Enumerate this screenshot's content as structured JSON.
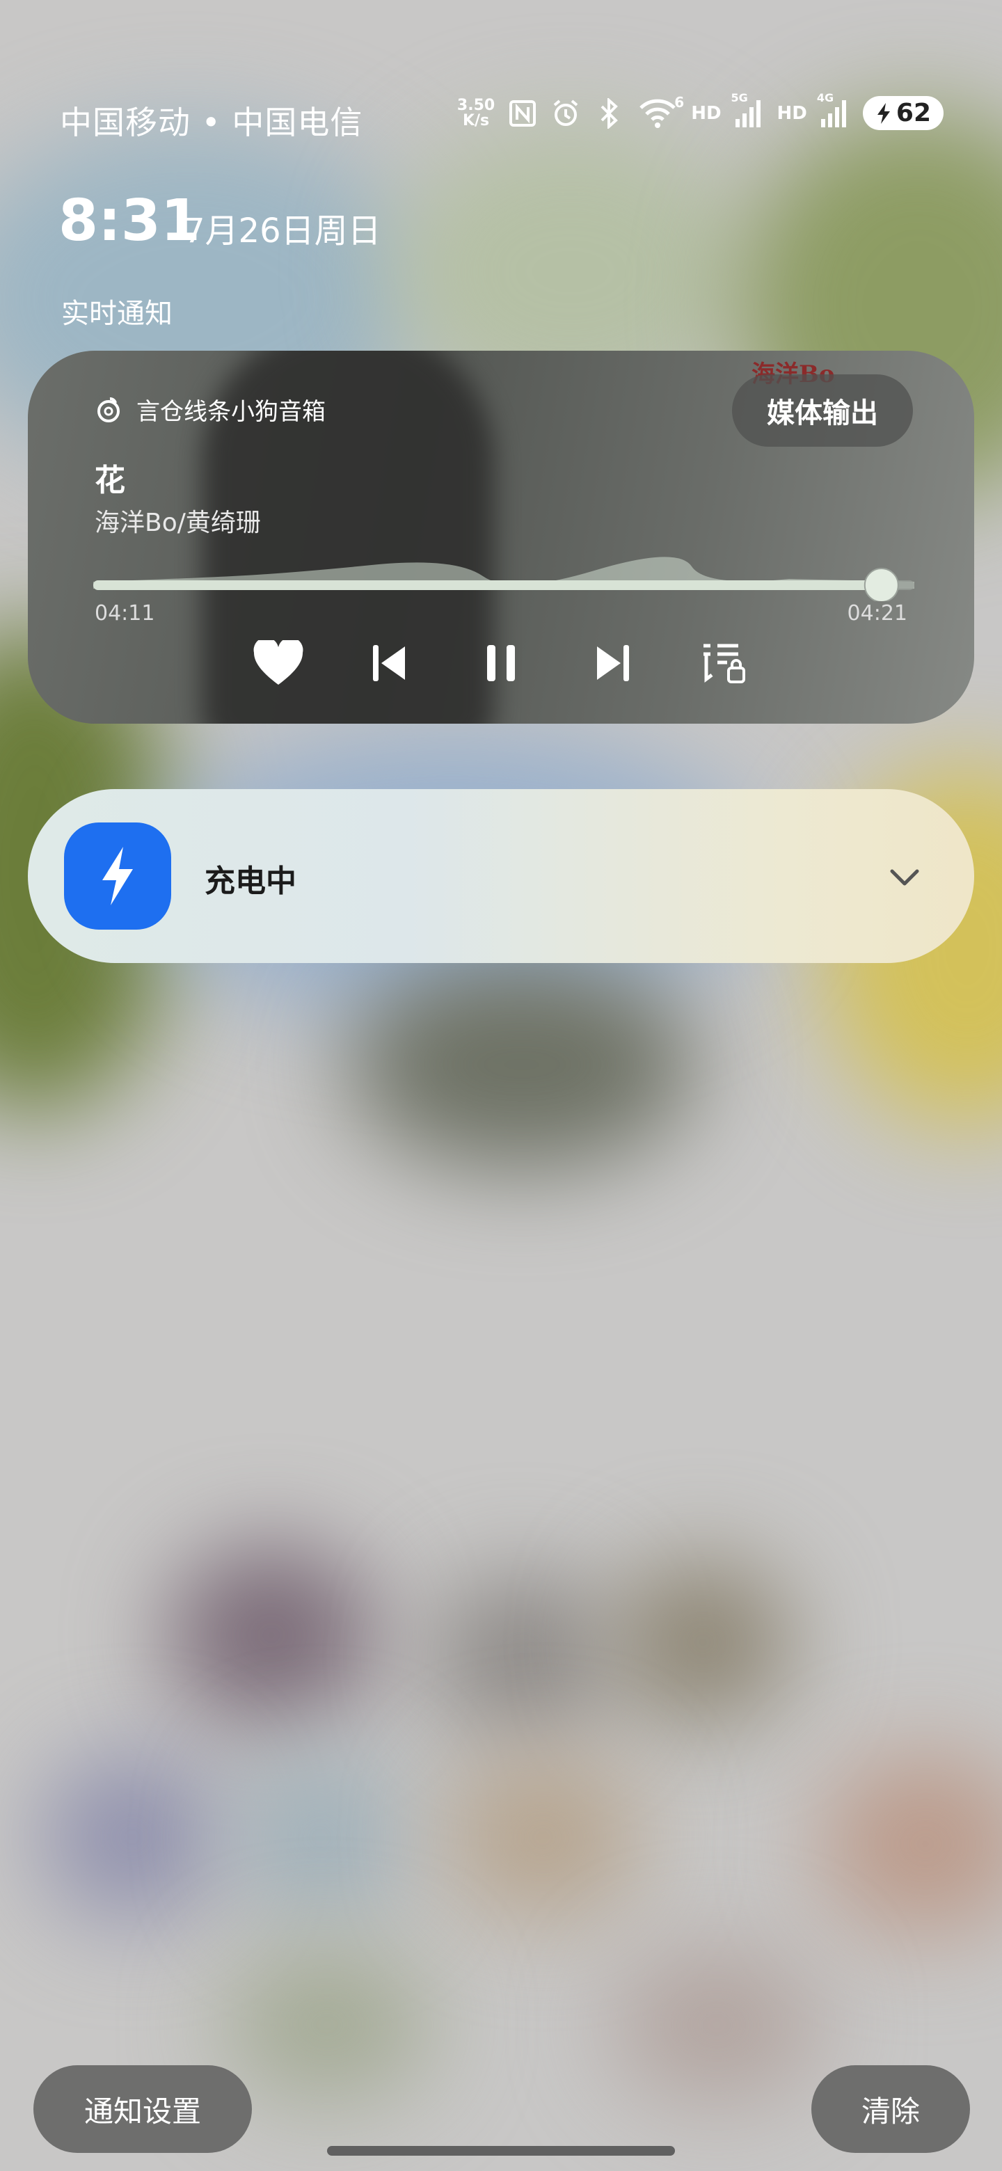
{
  "status_bar": {
    "carriers": "中国移动 • 中国电信",
    "speed_value": "3.50",
    "speed_unit": "K/s",
    "wifi_badge": "6",
    "hd1": "HD",
    "net1": "5G",
    "hd2": "HD",
    "net2": "4G",
    "battery": "62",
    "icons": [
      "nfc-icon",
      "alarm-icon",
      "bluetooth-icon",
      "wifi-icon",
      "signal-icon",
      "charging-bolt-icon"
    ]
  },
  "clock": {
    "time": "8:31",
    "date": "7月26日周日"
  },
  "section_title": "实时通知",
  "media": {
    "device": "言仓线条小狗音箱",
    "output_button": "媒体输出",
    "song": "花",
    "artist": "海洋Bo/黄绮珊",
    "watermark": "海洋Bo",
    "elapsed": "04:11",
    "duration": "04:21",
    "progress": 0.96,
    "controls": [
      "heart-icon",
      "previous-icon",
      "pause-icon",
      "next-icon",
      "lyrics-icon"
    ]
  },
  "charging": {
    "label": "充电中"
  },
  "bottom": {
    "settings": "通知设置",
    "clear": "清除"
  },
  "colors": {
    "accent": "#1e6ff0"
  }
}
